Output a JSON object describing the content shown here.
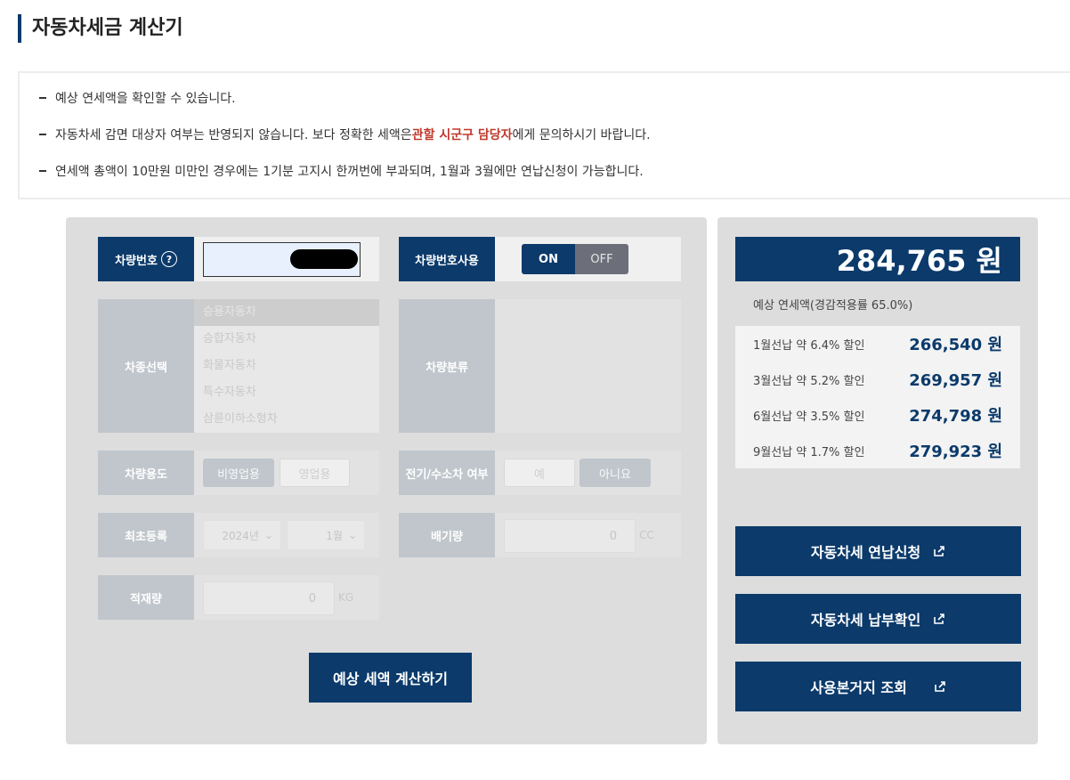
{
  "title": "자동차세금 계산기",
  "notices": {
    "n1": "예상 연세액을 확인할 수 있습니다.",
    "n2_pre": "자동차세 감면 대상자 여부는 반영되지 않습니다. 보다 정확한 세액은 ",
    "n2_highlight": "관할 시군구 담당자",
    "n2_post": "에게 문의하시기 바랍니다.",
    "n3": "연세액 총액이 10만원 미만인 경우에는 1기분 고지시 한꺼번에 부과되며, 1월과 3월에만 연납신청이 가능합니다."
  },
  "form": {
    "plate_label": "차량번호",
    "plate_help": "?",
    "plate_use_label": "차량번호사용",
    "toggle_on": "ON",
    "toggle_off": "OFF",
    "type_label": "차종선택",
    "types": [
      "승용자동차",
      "승합자동차",
      "화물자동차",
      "특수자동차",
      "삼륜이하소형차"
    ],
    "class_label": "차량분류",
    "usage_label": "차량용도",
    "usage_nonbiz": "비영업용",
    "usage_biz": "영업용",
    "ev_label": "전기/수소차 여부",
    "ev_yes": "예",
    "ev_no": "아니요",
    "reg_label": "최초등록",
    "reg_year": "2024년",
    "reg_month": "1월",
    "displacement_label": "배기량",
    "displacement_value": "0",
    "displacement_unit": "CC",
    "load_label": "적재량",
    "load_value": "0",
    "load_unit": "KG",
    "calc_button": "예상 세액 계산하기"
  },
  "result": {
    "total": "284,765 원",
    "subtitle": "예상 연세액(경감적용률 65.0%)",
    "discounts": [
      {
        "label": "1월선납 약 6.4% 할인",
        "value": "266,540 원"
      },
      {
        "label": "3월선납 약 5.2% 할인",
        "value": "269,957 원"
      },
      {
        "label": "6월선납 약 3.5% 할인",
        "value": "274,798 원"
      },
      {
        "label": "9월선납 약 1.7% 할인",
        "value": "279,923 원"
      }
    ],
    "btn_annual": "자동차세 연납신청",
    "btn_payment": "자동차세 납부확인",
    "btn_base": "사용본거지 조회"
  },
  "colors": {
    "primary": "#0b3a6b",
    "highlight": "#c0392b"
  }
}
